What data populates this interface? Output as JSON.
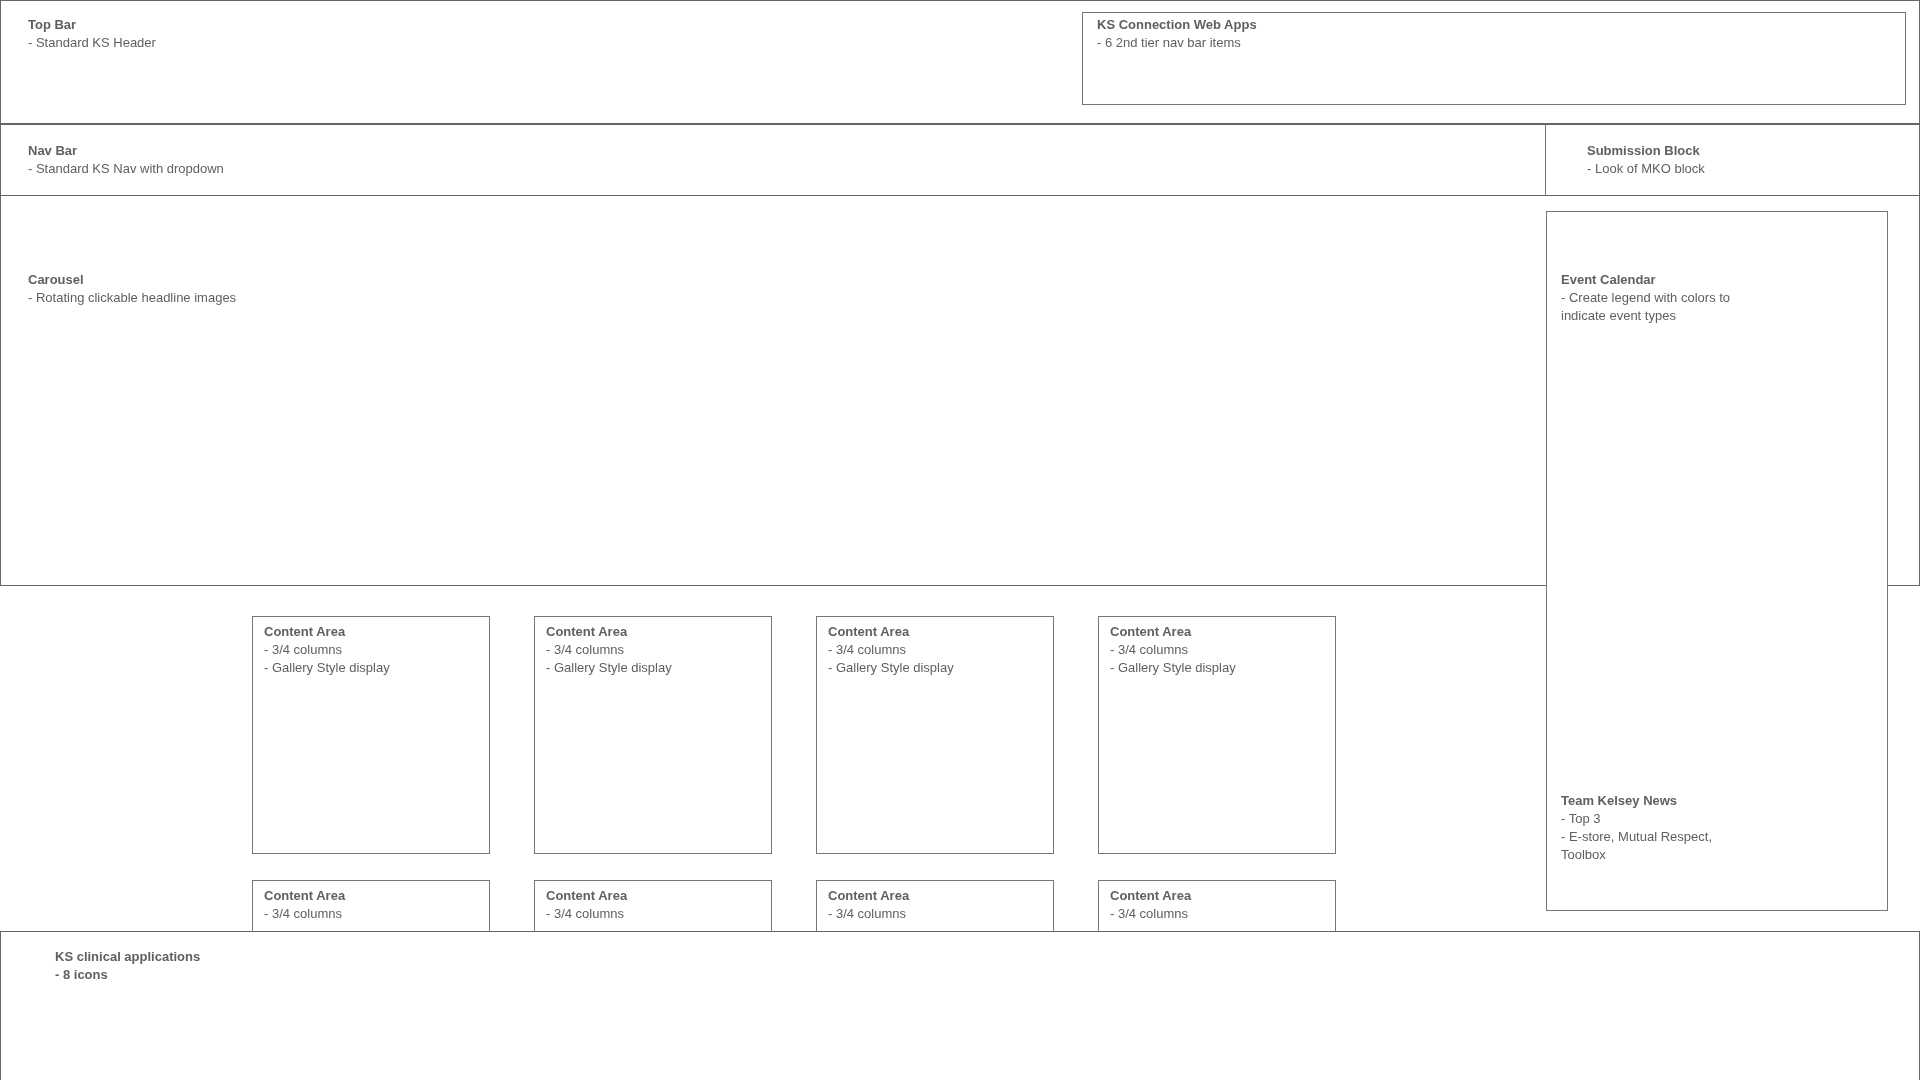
{
  "top_bar": {
    "title": "Top Bar",
    "lines": [
      "- Standard KS Header"
    ]
  },
  "web_apps": {
    "title": "KS Connection Web Apps",
    "lines": [
      "- 6 2nd tier nav bar items"
    ]
  },
  "nav_bar": {
    "title": "Nav Bar",
    "lines": [
      "- Standard KS Nav with dropdown"
    ]
  },
  "submission_block": {
    "title": "Submission Block",
    "lines": [
      "- Look of MKO block"
    ]
  },
  "carousel": {
    "title": "Carousel",
    "lines": [
      "- Rotating clickable headline images"
    ]
  },
  "sidebar": {
    "event_calendar": {
      "title": "Event Calendar",
      "lines": [
        "- Create legend with colors to indicate event types"
      ]
    },
    "news": {
      "title": "Team Kelsey News",
      "lines": [
        "- Top 3",
        "- E-store, Mutual Respect, Toolbox"
      ]
    }
  },
  "content_rows": [
    [
      {
        "title": "Content Area",
        "lines": [
          "- 3/4 columns",
          "- Gallery Style display"
        ]
      },
      {
        "title": "Content Area",
        "lines": [
          "- 3/4 columns",
          "- Gallery Style display"
        ]
      },
      {
        "title": "Content Area",
        "lines": [
          "- 3/4 columns",
          "- Gallery Style display"
        ]
      },
      {
        "title": "Content Area",
        "lines": [
          "- 3/4 columns",
          "- Gallery Style display"
        ]
      }
    ],
    [
      {
        "title": "Content Area",
        "lines": [
          "- 3/4 columns"
        ]
      },
      {
        "title": "Content Area",
        "lines": [
          "- 3/4 columns"
        ]
      },
      {
        "title": "Content Area",
        "lines": [
          "- 3/4 columns"
        ]
      },
      {
        "title": "Content Area",
        "lines": [
          "- 3/4 columns"
        ]
      }
    ]
  ],
  "footer": {
    "title": "KS clinical applications",
    "lines": [
      "- 8 icons"
    ]
  }
}
